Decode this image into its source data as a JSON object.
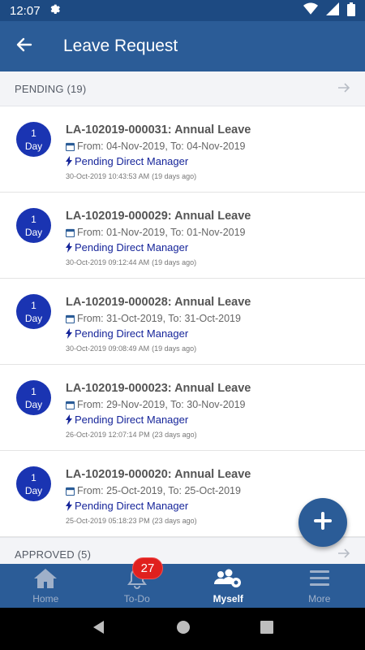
{
  "status_bar": {
    "time": "12:07",
    "icons": [
      "settings-gear-icon",
      "wifi-icon",
      "cell-signal-icon",
      "battery-icon"
    ]
  },
  "app_bar": {
    "title": "Leave Request",
    "back_icon": "arrow-back-icon"
  },
  "sections": {
    "pending": {
      "label": "PENDING (19)",
      "arrow_icon": "arrow-right-icon"
    },
    "approved": {
      "label": "APPROVED (5)",
      "arrow_icon": "arrow-right-icon"
    }
  },
  "requests": [
    {
      "badge_num": "1",
      "badge_unit": "Day",
      "title": "LA-102019-000031: Annual Leave",
      "dates": "From: 04-Nov-2019, To: 04-Nov-2019",
      "status": "Pending Direct Manager",
      "created": "30-Oct-2019 10:43:53 AM",
      "ago": "(19 days  ago)"
    },
    {
      "badge_num": "1",
      "badge_unit": "Day",
      "title": "LA-102019-000029: Annual Leave",
      "dates": "From: 01-Nov-2019, To: 01-Nov-2019",
      "status": "Pending Direct Manager",
      "created": "30-Oct-2019 09:12:44 AM",
      "ago": "(19 days  ago)"
    },
    {
      "badge_num": "1",
      "badge_unit": "Day",
      "title": "LA-102019-000028: Annual Leave",
      "dates": "From: 31-Oct-2019, To: 31-Oct-2019",
      "status": "Pending Direct Manager",
      "created": "30-Oct-2019 09:08:49 AM",
      "ago": "(19 days  ago)"
    },
    {
      "badge_num": "1",
      "badge_unit": "Day",
      "title": "LA-102019-000023: Annual Leave",
      "dates": "From: 29-Nov-2019, To: 30-Nov-2019",
      "status": "Pending Direct Manager",
      "created": "26-Oct-2019 12:07:14 PM",
      "ago": "(23 days  ago)"
    },
    {
      "badge_num": "1",
      "badge_unit": "Day",
      "title": "LA-102019-000020: Annual Leave",
      "dates": "From: 25-Oct-2019, To: 25-Oct-2019",
      "status": "Pending Direct Manager",
      "created": "25-Oct-2019 05:18:23 PM",
      "ago": "(23 days  ago)"
    }
  ],
  "fab": {
    "icon": "plus-icon"
  },
  "bottom_nav": {
    "items": [
      {
        "label": "Home",
        "icon": "home-icon"
      },
      {
        "label": "To-Do",
        "icon": "bell-icon"
      },
      {
        "label": "Myself",
        "icon": "people-gear-icon"
      },
      {
        "label": "More",
        "icon": "menu-icon"
      }
    ],
    "todo_count": "27"
  },
  "system_nav": [
    "back-triangle-icon",
    "home-circle-icon",
    "recents-square-icon"
  ],
  "colors": {
    "primary": "#2b5c97",
    "status_bar": "#1d4a82",
    "badge": "#1a34b2",
    "status_text": "#16259a",
    "count_badge": "#e0201e"
  }
}
